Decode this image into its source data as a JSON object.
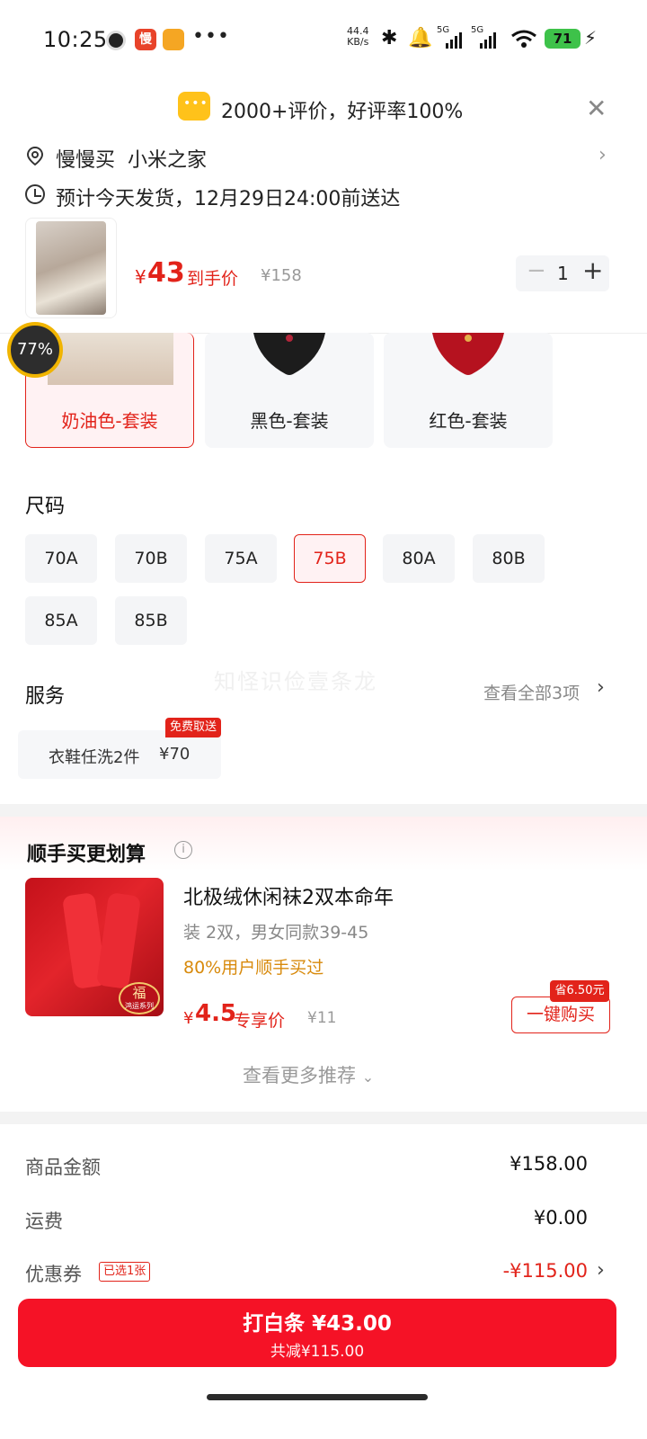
{
  "status_bar": {
    "time": "10:25",
    "net_speed_value": "44.4",
    "net_speed_unit": "KB/s",
    "signal1": "5G",
    "signal2": "5G",
    "battery": "71"
  },
  "header": {
    "review_summary": "2000+评价，好评率100%",
    "address_shop": "慢慢买",
    "address_name": "小米之家",
    "shipping": "预计今天发货，12月29日24:00前送达"
  },
  "product": {
    "price_symbol": "¥",
    "price": "43",
    "price_tag": "到手价",
    "original_price": "¥158",
    "quantity": "1"
  },
  "scroll_progress": "77%",
  "colors": {
    "options": [
      "奶油色-套装",
      "黑色-套装",
      "红色-套装"
    ],
    "selected_index": 0
  },
  "size": {
    "title": "尺码",
    "options": [
      "70A",
      "70B",
      "75A",
      "75B",
      "80A",
      "80B",
      "85A",
      "85B"
    ],
    "selected": "75B"
  },
  "watermark": "知怪识俭壹条龙",
  "service": {
    "title": "服务",
    "see_all": "查看全部3项",
    "item_name": "衣鞋任洗2件",
    "item_price": "¥70",
    "item_badge": "免费取送"
  },
  "addon": {
    "title": "顺手买更划算",
    "img_badge": "福",
    "img_badge_sub": "鸿运系列",
    "name": "北极绒休闲袜2双本命年",
    "spec": "装 2双，男女同款39-45",
    "promo": "80%用户顺手买过",
    "price_symbol": "¥",
    "price": "4.5",
    "price_tag": "专享价",
    "original_price": "¥11",
    "save_tag": "省6.50元",
    "buy_label": "一键购买",
    "more_label": "查看更多推荐"
  },
  "summary": {
    "goods_label": "商品金额",
    "goods_value": "¥158.00",
    "shipping_label": "运费",
    "shipping_value": "¥0.00",
    "coupon_label": "优惠券",
    "coupon_tag": "已选1张",
    "coupon_value": "-¥115.00"
  },
  "pay": {
    "main": "打白条 ¥43.00",
    "sub": "共减¥115.00"
  },
  "colors_theme": {
    "accent": "#e2231a",
    "pay_button": "#f51226",
    "promo": "#d88a0c"
  }
}
